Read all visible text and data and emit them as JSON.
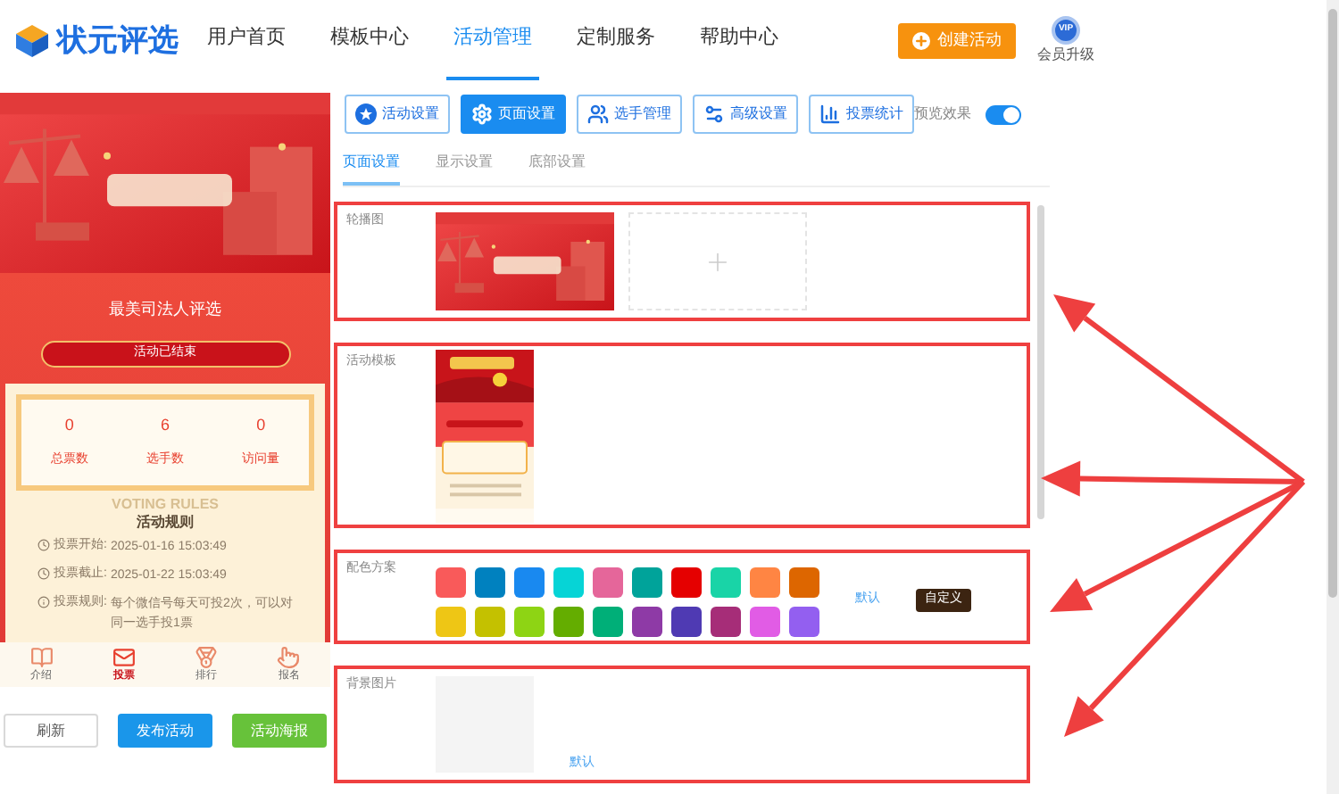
{
  "header": {
    "logo_text": "状元评选",
    "nav": [
      {
        "label": "用户首页",
        "selected": false
      },
      {
        "label": "模板中心",
        "selected": false
      },
      {
        "label": "活动管理",
        "selected": true
      },
      {
        "label": "定制服务",
        "selected": false
      },
      {
        "label": "帮助中心",
        "selected": false
      }
    ],
    "create_button": "创建活动",
    "vip_badge": "VIP",
    "vip_label": "会员升级"
  },
  "preview": {
    "title": "最美司法人评选",
    "status": "活动已结束",
    "stats": [
      {
        "value": "0",
        "label": "总票数"
      },
      {
        "value": "6",
        "label": "选手数"
      },
      {
        "value": "0",
        "label": "访问量"
      }
    ],
    "rules_watermark": "VOTING RULES",
    "rules_title": "活动规则",
    "rules": [
      {
        "kind": "clock",
        "label": "投票开始:",
        "value": "2025-01-16 15:03:49"
      },
      {
        "kind": "clock",
        "label": "投票截止:",
        "value": "2025-01-22 15:03:49"
      },
      {
        "kind": "info",
        "label": "投票规则:",
        "value": "每个微信号每天可投2次，可以对同一选手投1票"
      }
    ],
    "bottom_nav": [
      {
        "kind": "book",
        "label": "介绍",
        "selected": false
      },
      {
        "kind": "vote",
        "label": "投票",
        "selected": true
      },
      {
        "kind": "medal",
        "label": "排行",
        "selected": false
      },
      {
        "kind": "hand",
        "label": "报名",
        "selected": false
      }
    ]
  },
  "actions": [
    {
      "kind": "plain",
      "label": "刷新"
    },
    {
      "kind": "primary",
      "label": "发布活动"
    },
    {
      "kind": "success",
      "label": "活动海报"
    }
  ],
  "toolbar": {
    "buttons": [
      {
        "kind": "star",
        "label": "活动设置",
        "selected": false
      },
      {
        "kind": "gear",
        "label": "页面设置",
        "selected": true
      },
      {
        "kind": "users",
        "label": "选手管理",
        "selected": false
      },
      {
        "kind": "sliders",
        "label": "高级设置",
        "selected": false
      },
      {
        "kind": "chart",
        "label": "投票统计",
        "selected": false
      }
    ],
    "preview_toggle": {
      "label": "预览效果",
      "on": true
    }
  },
  "subtabs": [
    {
      "label": "页面设置",
      "selected": true
    },
    {
      "label": "显示设置",
      "selected": false
    },
    {
      "label": "底部设置",
      "selected": false
    }
  ],
  "sections": [
    {
      "kind": "carousel",
      "label": "轮播图"
    },
    {
      "kind": "template",
      "label": "活动模板"
    },
    {
      "kind": "colors",
      "label": "配色方案",
      "colors": [
        {
          "color": "#f95a5a"
        },
        {
          "color": "#0081bf"
        },
        {
          "color": "#1989f0"
        },
        {
          "color": "#06d4d6"
        },
        {
          "color": "#e5669a"
        },
        {
          "color": "#00a39a"
        },
        {
          "color": "#e50000"
        },
        {
          "color": "#19d4a7"
        },
        {
          "color": "#ff8543"
        },
        {
          "color": "#dd6600"
        },
        {
          "color": "#eec615"
        },
        {
          "color": "#c4c100"
        },
        {
          "color": "#8ed414"
        },
        {
          "color": "#64ad00"
        },
        {
          "color": "#00af78"
        },
        {
          "color": "#8e3aa6"
        },
        {
          "color": "#4f3ab3"
        },
        {
          "color": "#a62d78"
        },
        {
          "color": "#e15ce5"
        },
        {
          "color": "#935ff0"
        }
      ],
      "default_link": "默认",
      "custom_button": "自定义"
    },
    {
      "kind": "background",
      "label": "背景图片",
      "default_link": "默认"
    }
  ]
}
